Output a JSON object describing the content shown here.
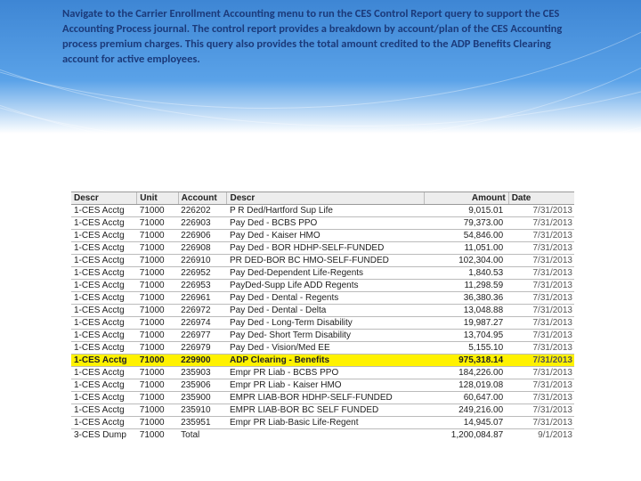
{
  "callout": "Navigate to the Carrier Enrollment Accounting menu to run the CES Control Report query to support the CES Accounting Process journal.  The control report provides a breakdown by account/plan of the CES Accounting process premium charges.  This query also provides the total amount credited to the ADP Benefits Clearing account for active employees.",
  "table": {
    "headers": {
      "descr1": "Descr",
      "unit": "Unit",
      "account": "Account",
      "descr2": "Descr",
      "amount": "Amount",
      "date": "Date"
    },
    "rows": [
      {
        "descr1": "1-CES Acctg",
        "unit": "71000",
        "account": "226202",
        "descr2": "P R Ded/Hartford Sup Life",
        "amount": "9,015.01",
        "date": "7/31/2013",
        "hl": false
      },
      {
        "descr1": "1-CES Acctg",
        "unit": "71000",
        "account": "226903",
        "descr2": "Pay Ded - BCBS PPO",
        "amount": "79,373.00",
        "date": "7/31/2013",
        "hl": false
      },
      {
        "descr1": "1-CES Acctg",
        "unit": "71000",
        "account": "226906",
        "descr2": "Pay Ded - Kaiser HMO",
        "amount": "54,846.00",
        "date": "7/31/2013",
        "hl": false
      },
      {
        "descr1": "1-CES Acctg",
        "unit": "71000",
        "account": "226908",
        "descr2": "Pay Ded - BOR HDHP-SELF-FUNDED",
        "amount": "11,051.00",
        "date": "7/31/2013",
        "hl": false
      },
      {
        "descr1": "1-CES Acctg",
        "unit": "71000",
        "account": "226910",
        "descr2": "PR DED-BOR BC HMO-SELF-FUNDED",
        "amount": "102,304.00",
        "date": "7/31/2013",
        "hl": false
      },
      {
        "descr1": "1-CES Acctg",
        "unit": "71000",
        "account": "226952",
        "descr2": "Pay Ded-Dependent Life-Regents",
        "amount": "1,840.53",
        "date": "7/31/2013",
        "hl": false
      },
      {
        "descr1": "1-CES Acctg",
        "unit": "71000",
        "account": "226953",
        "descr2": "PayDed-Supp Life ADD Regents",
        "amount": "11,298.59",
        "date": "7/31/2013",
        "hl": false
      },
      {
        "descr1": "1-CES Acctg",
        "unit": "71000",
        "account": "226961",
        "descr2": "Pay Ded - Dental - Regents",
        "amount": "36,380.36",
        "date": "7/31/2013",
        "hl": false
      },
      {
        "descr1": "1-CES Acctg",
        "unit": "71000",
        "account": "226972",
        "descr2": "Pay Ded - Dental - Delta",
        "amount": "13,048.88",
        "date": "7/31/2013",
        "hl": false
      },
      {
        "descr1": "1-CES Acctg",
        "unit": "71000",
        "account": "226974",
        "descr2": "Pay Ded - Long-Term Disability",
        "amount": "19,987.27",
        "date": "7/31/2013",
        "hl": false
      },
      {
        "descr1": "1-CES Acctg",
        "unit": "71000",
        "account": "226977",
        "descr2": "Pay Ded- Short Term Disability",
        "amount": "13,704.95",
        "date": "7/31/2013",
        "hl": false
      },
      {
        "descr1": "1-CES Acctg",
        "unit": "71000",
        "account": "226979",
        "descr2": "Pay Ded - Vision/Med EE",
        "amount": "5,155.10",
        "date": "7/31/2013",
        "hl": false
      },
      {
        "descr1": "1-CES Acctg",
        "unit": "71000",
        "account": "229900",
        "descr2": "ADP Clearing - Benefits",
        "amount": "975,318.14",
        "date": "7/31/2013",
        "hl": true
      },
      {
        "descr1": "1-CES Acctg",
        "unit": "71000",
        "account": "235903",
        "descr2": "Empr PR Liab - BCBS PPO",
        "amount": "184,226.00",
        "date": "7/31/2013",
        "hl": false
      },
      {
        "descr1": "1-CES Acctg",
        "unit": "71000",
        "account": "235906",
        "descr2": "Empr PR Liab - Kaiser HMO",
        "amount": "128,019.08",
        "date": "7/31/2013",
        "hl": false
      },
      {
        "descr1": "1-CES Acctg",
        "unit": "71000",
        "account": "235900",
        "descr2": "EMPR LIAB-BOR HDHP-SELF-FUNDED",
        "amount": "60,647.00",
        "date": "7/31/2013",
        "hl": false
      },
      {
        "descr1": "1-CES Acctg",
        "unit": "71000",
        "account": "235910",
        "descr2": "EMPR LIAB-BOR BC SELF FUNDED",
        "amount": "249,216.00",
        "date": "7/31/2013",
        "hl": false
      },
      {
        "descr1": "1-CES Acctg",
        "unit": "71000",
        "account": "235951",
        "descr2": "Empr PR Liab-Basic Life-Regent",
        "amount": "14,945.07",
        "date": "7/31/2013",
        "hl": false
      },
      {
        "descr1": "3-CES Dump",
        "unit": "71000",
        "account": "Total",
        "descr2": "",
        "amount": "1,200,084.87",
        "date": "9/1/2013",
        "hl": false
      }
    ]
  }
}
